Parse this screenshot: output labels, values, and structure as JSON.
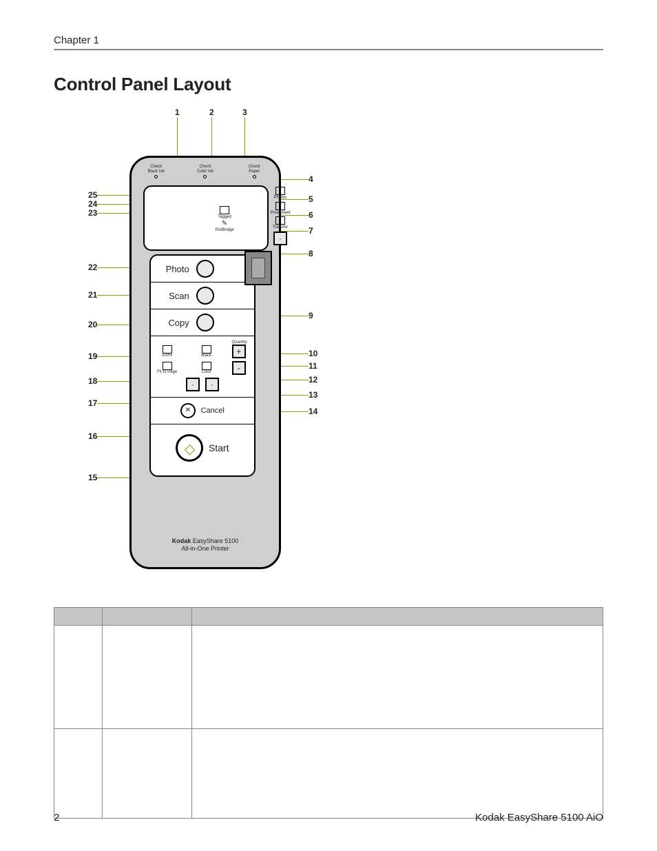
{
  "header": {
    "chapter": "Chapter 1"
  },
  "title": "Control Panel Layout",
  "callouts": {
    "top": [
      "1",
      "2",
      "3"
    ],
    "right": [
      "4",
      "5",
      "6",
      "7",
      "8",
      "9",
      "10",
      "11",
      "12",
      "13",
      "14"
    ],
    "left_upper": [
      "25",
      "24",
      "23"
    ],
    "left_mid": [
      "22",
      "21",
      "20",
      "19",
      "18",
      "17",
      "16",
      "15"
    ]
  },
  "leds": [
    {
      "label_l1": "Check",
      "label_l2": "Black Ink"
    },
    {
      "label_l1": "Check",
      "label_l2": "Color Ink"
    },
    {
      "label_l1": "Check",
      "label_l2": "Paper"
    }
  ],
  "side_icons": [
    {
      "label": "Photos"
    },
    {
      "label": "Proofsheet"
    },
    {
      "label": "Transfer"
    },
    {
      "label": ""
    }
  ],
  "rows": {
    "photo": "Photo",
    "scan": "Scan",
    "copy": "Copy",
    "cancel": "Cancel",
    "start": "Start"
  },
  "mid_icons": {
    "tagged": "Tagged",
    "pictbridge": "PictBridge"
  },
  "copy_area": {
    "quantity": "Quantity",
    "black": "Black",
    "color": "Color",
    "hundred": "100%",
    "fit": "Fit to Page",
    "plus": "+",
    "minus": "-"
  },
  "brand": {
    "bold": "Kodak",
    "rest": " EasyShare 5100",
    "line2": "All-in-One Printer"
  },
  "footer": {
    "page": "2",
    "product": "Kodak EasyShare 5100 AiO"
  }
}
